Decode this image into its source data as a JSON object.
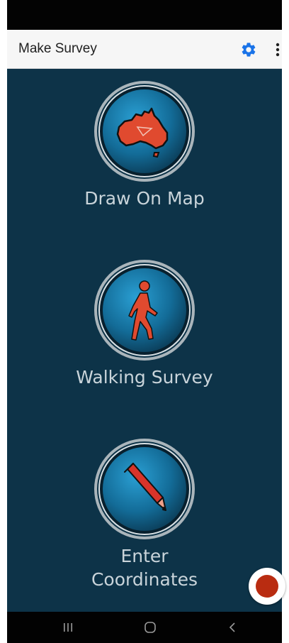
{
  "app_bar": {
    "title": "Make Survey",
    "icons": [
      "gear-icon",
      "more-vert-icon"
    ],
    "accent_color": "#1a73e8"
  },
  "options": [
    {
      "label": "Draw On Map",
      "icon": "australia-map-icon"
    },
    {
      "label": "Walking Survey",
      "icon": "walking-person-icon"
    },
    {
      "label": "Enter Coordinates",
      "label_lines": [
        "Enter",
        "Coordinates"
      ],
      "icon": "pencil-icon"
    }
  ],
  "fab": {
    "icon": "record-icon",
    "color": "#b92c11"
  },
  "nav_bar": {
    "icons": [
      "recents-icon",
      "home-icon",
      "back-icon"
    ]
  },
  "colors": {
    "background": "#0d3348",
    "label": "#c9d4da",
    "icon_red": "#e04a2f"
  }
}
